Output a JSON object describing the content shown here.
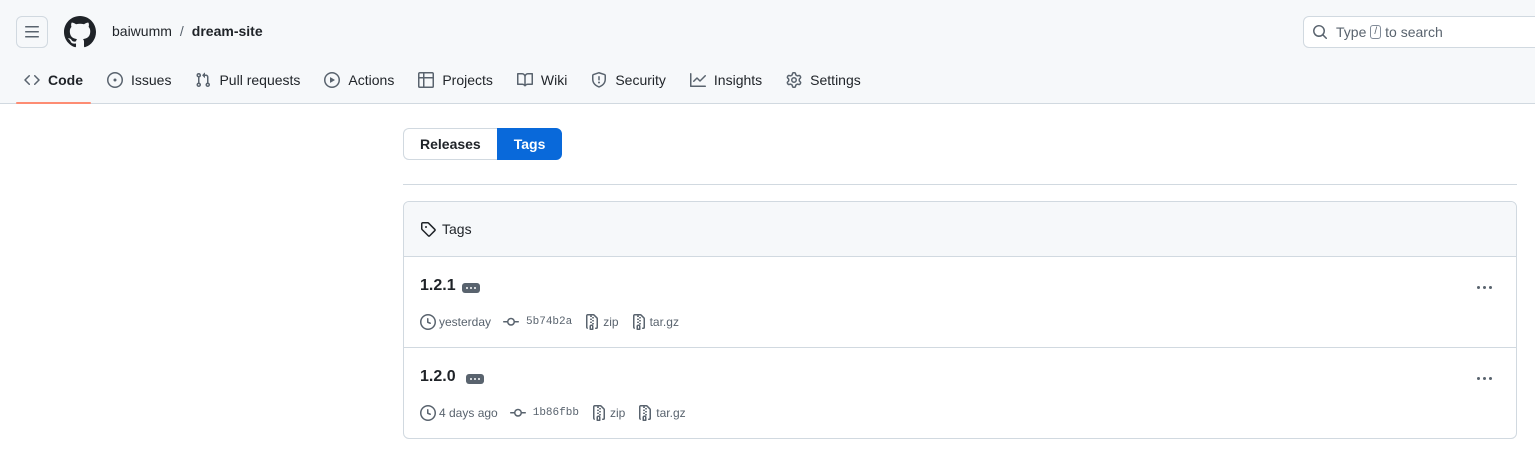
{
  "header": {
    "owner": "baiwumm",
    "separator": "/",
    "repo": "dream-site",
    "search": {
      "prefix": "Type",
      "key": "/",
      "suffix": "to search"
    }
  },
  "nav": {
    "items": [
      {
        "label": "Code",
        "icon": "code-icon"
      },
      {
        "label": "Issues",
        "icon": "issue-icon"
      },
      {
        "label": "Pull requests",
        "icon": "pull-request-icon"
      },
      {
        "label": "Actions",
        "icon": "play-icon"
      },
      {
        "label": "Projects",
        "icon": "table-icon"
      },
      {
        "label": "Wiki",
        "icon": "book-icon"
      },
      {
        "label": "Security",
        "icon": "shield-icon"
      },
      {
        "label": "Insights",
        "icon": "graph-icon"
      },
      {
        "label": "Settings",
        "icon": "gear-icon"
      }
    ],
    "active": "Code",
    "active_underline_color": "#fd8c73"
  },
  "toggle": {
    "releases_label": "Releases",
    "tags_label": "Tags",
    "selected": "Tags",
    "accent": "#0969da"
  },
  "tags_box": {
    "title": "Tags",
    "tags": [
      {
        "name": "1.2.1",
        "date": "yesterday",
        "commit": "5b74b2a",
        "zip": "zip",
        "targz": "tar.gz"
      },
      {
        "name": "1.2.0",
        "date": "4 days ago",
        "commit": "1b86fbb",
        "zip": "zip",
        "targz": "tar.gz"
      }
    ]
  }
}
